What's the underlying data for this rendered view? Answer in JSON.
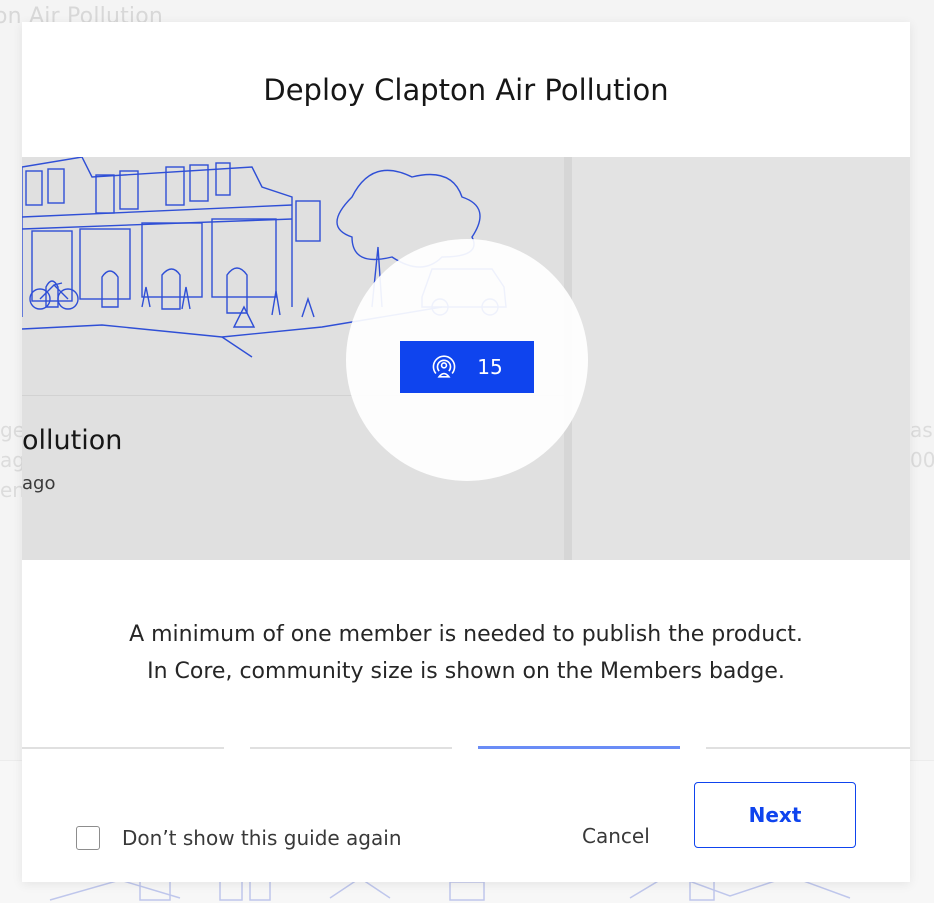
{
  "background": {
    "page_title_fragment": "on Air Pollution",
    "left_edge_chars": [
      "ge",
      "ag",
      "en"
    ],
    "right_edge_chars": [
      "as",
      "00"
    ]
  },
  "modal": {
    "title": "Deploy Clapton Air Pollution",
    "card": {
      "title_fragment": "ollution",
      "subtitle_fragment": "ago"
    },
    "members_badge": {
      "icon": "broadcast-user-icon",
      "count": "15"
    },
    "description": [
      "A minimum of one member is needed to publish the product.",
      "In Core, community size is shown on the Members badge."
    ],
    "steps": {
      "total": 4,
      "active_index": 2
    },
    "footer": {
      "checkbox_label": "Don’t show this guide again",
      "checkbox_checked": false,
      "cancel_label": "Cancel",
      "next_label": "Next"
    }
  },
  "colors": {
    "accent": "#0f44ee",
    "progress_active": "#6a8cf6",
    "hero_background": "#e0e0e0"
  }
}
